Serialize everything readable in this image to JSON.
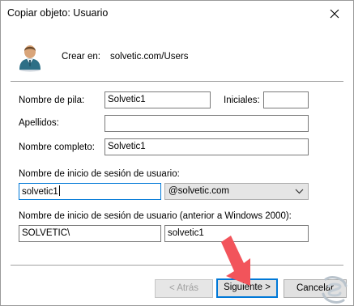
{
  "window": {
    "title": "Copiar objeto: Usuario"
  },
  "header": {
    "create_label": "Crear en:",
    "create_value": "solvetic.com/Users",
    "icon": "user-icon"
  },
  "form": {
    "first_name_label": "Nombre de pila:",
    "first_name_value": "Solvetic1",
    "initials_label": "Iniciales:",
    "initials_value": "",
    "last_name_label": "Apellidos:",
    "last_name_value": "",
    "full_name_label": "Nombre completo:",
    "full_name_value": "Solvetic1",
    "logon_label": "Nombre de inicio de sesión de usuario:",
    "logon_value": "solvetic1",
    "domain_value": "@solvetic.com",
    "pre2000_label": "Nombre de inicio de sesión de usuario (anterior a Windows 2000):",
    "pre2000_domain_value": "SOLVETIC\\",
    "pre2000_user_value": "solvetic1"
  },
  "buttons": {
    "back": "< Atrás",
    "next": "Siguiente >",
    "cancel": "Cancelar"
  },
  "colors": {
    "focus_border": "#0078d7",
    "annotation_arrow": "#f2545b"
  }
}
